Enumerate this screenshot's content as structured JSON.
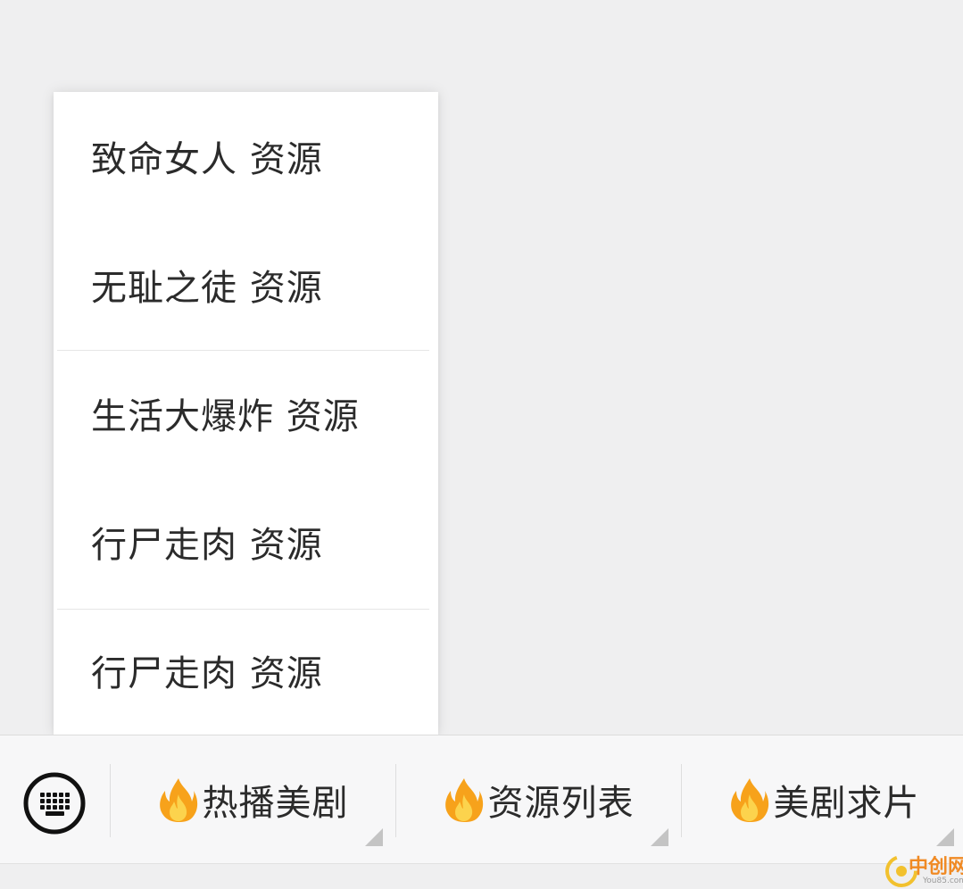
{
  "popup_menu": {
    "items": [
      {
        "label": "致命女人 资源"
      },
      {
        "label": "无耻之徒 资源"
      },
      {
        "label": "生活大爆炸 资源"
      },
      {
        "label": "行尸走肉 资源"
      },
      {
        "label": "行尸走肉 资源"
      }
    ]
  },
  "bottom_menu": {
    "keyboard_icon": "keyboard-icon",
    "tabs": [
      {
        "label": "热播美剧",
        "icon": "fire-icon"
      },
      {
        "label": "资源列表",
        "icon": "fire-icon"
      },
      {
        "label": "美剧求片",
        "icon": "fire-icon"
      }
    ]
  },
  "watermark": {
    "text": "中创网",
    "subtext": "You85.com"
  },
  "colors": {
    "background": "#efeff0",
    "menu_background": "#ffffff",
    "text": "#2b2b2b",
    "fire_outer": "#f7a21b",
    "fire_inner": "#fcd34d",
    "watermark": "#f08a24"
  }
}
